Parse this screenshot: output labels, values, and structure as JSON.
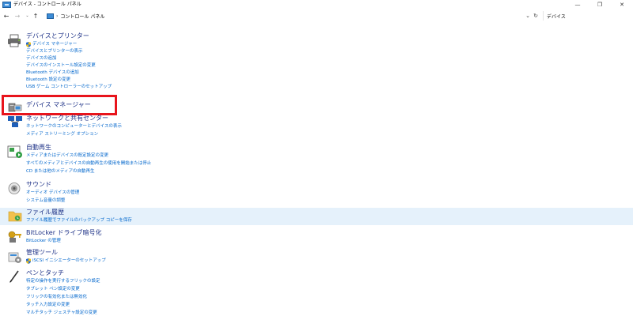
{
  "window": {
    "title": "デバイス - コントロール パネル",
    "controls": [
      "—",
      "❐",
      "✕"
    ]
  },
  "addressbar": {
    "back": "←",
    "forward": "→",
    "recent": "⌄",
    "up": "↑",
    "separator": "›",
    "path": "コントロール パネル",
    "search_value": "デバイス"
  },
  "sections": [
    {
      "title": "デバイスとプリンター",
      "icon": "printer-icon",
      "links": [
        {
          "label": "デバイス マネージャー",
          "shield": true
        },
        {
          "label": "デバイスとプリンターの表示"
        },
        {
          "label": "デバイスの追加"
        },
        {
          "label": "デバイスのインストール設定の変更"
        },
        {
          "label": "Bluetooth デバイスの追加"
        },
        {
          "label": "Bluetooth 設定の変更"
        },
        {
          "label": "USB ゲーム コントローラーのセットアップ"
        }
      ]
    },
    {
      "title": "デバイス マネージャー",
      "icon": "device-manager-icon",
      "links": []
    },
    {
      "title": "ネットワークと共有センター",
      "icon": "network-icon",
      "links": [
        {
          "label": "ネットワークのコンピューターとデバイスの表示"
        },
        {
          "label": "メディア ストリーミング オプション"
        }
      ]
    },
    {
      "title": "自動再生",
      "icon": "autoplay-icon",
      "links": [
        {
          "label": "メディアまたはデバイスの既定設定の変更"
        },
        {
          "label": "すべてのメディアとデバイスの自動再生の使用を開始または停止"
        },
        {
          "label": "CD または他のメディアの自動再生"
        }
      ]
    },
    {
      "title": "サウンド",
      "icon": "speaker-icon",
      "links": [
        {
          "label": "オーディオ デバイスの管理"
        },
        {
          "label": "システム音量の調整"
        }
      ]
    },
    {
      "title": "ファイル履歴",
      "icon": "file-history-icon",
      "links": [
        {
          "label": "ファイル履歴でファイルのバックアップ コピーを保存"
        }
      ]
    },
    {
      "title": "BitLocker ドライブ暗号化",
      "icon": "bitlocker-icon",
      "links": [
        {
          "label": "BitLocker の管理"
        }
      ]
    },
    {
      "title": "管理ツール",
      "icon": "admin-tools-icon",
      "links": [
        {
          "label": "iSCSI イニシエーターのセットアップ",
          "shield": true
        }
      ]
    },
    {
      "title": "ペンとタッチ",
      "icon": "pen-icon",
      "links": [
        {
          "label": "特定の操作を実行するフリックの設定"
        },
        {
          "label": "タブレット ペン設定の変更"
        },
        {
          "label": "フリックの有効化または無効化"
        },
        {
          "label": "タッチ入力設定の変更"
        },
        {
          "label": "マルチタッチ ジェスチャ設定の変更"
        }
      ]
    }
  ],
  "highlight_section": "ファイル履歴",
  "colors": {
    "title": "#1e3287",
    "link": "#0066cc",
    "highlight": "#e5f1fb",
    "annotation": "#e8141c"
  }
}
